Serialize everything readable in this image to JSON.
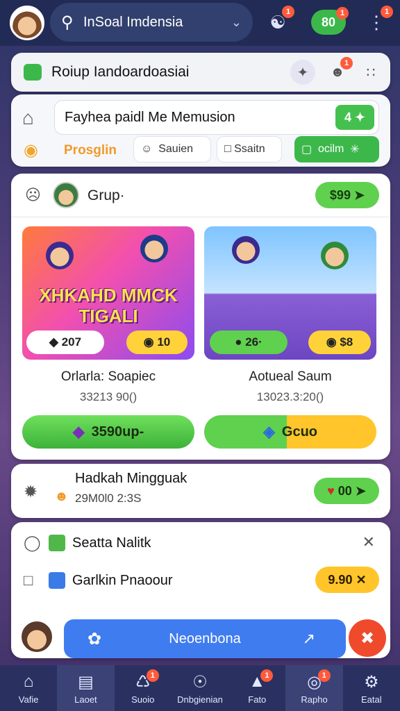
{
  "header": {
    "search_text": "InSoal Imdensia",
    "coin_count": "80",
    "badges": {
      "user": "1",
      "coin": "1",
      "more": "1"
    }
  },
  "group_card": {
    "title": "Roiup Iandoardoasiai",
    "badge": "1"
  },
  "compose": {
    "input_value": "Fayhea paidl Me Memusion",
    "send_label": "4",
    "progress_label": "Prosglin",
    "chip1": "Sauien",
    "chip2": "Ssaitn",
    "chip3": "ocilm"
  },
  "feed": {
    "title": "Grup·",
    "price": "$99",
    "games": [
      {
        "image_text_line1": "XHKAHD MMCK",
        "image_text_line2": "TIGALI",
        "pill_left": "207",
        "pill_right": "10",
        "name": "Orlarla: Soapiec",
        "sub": "33213 90()",
        "button": "3590up-"
      },
      {
        "pill_left": "26·",
        "pill_right": "$8",
        "name": "Aotueal Saum",
        "sub": "13023.3:20()",
        "button": "Gcuo"
      }
    ]
  },
  "activity": {
    "title": "Hadkah Mingguak",
    "time": "29M0l0 2:3S",
    "value": "00"
  },
  "list": {
    "row1": "Seatta Nalitk",
    "row2": "Garlkin Pnaoour",
    "price": "9.90"
  },
  "main_action": {
    "label": "Neoenbona"
  },
  "nav": {
    "items": [
      "Vafie",
      "Laoet",
      "Suoio",
      "Dnbgienian",
      "Fato",
      "Rapho",
      "Eatal"
    ],
    "badges": {
      "suoio": "1",
      "fato": "1",
      "rapho": "1"
    }
  },
  "colors": {
    "primary_blue": "#3f7cf0",
    "accent_green": "#5fd14e",
    "accent_yellow": "#ffc52a",
    "accent_orange": "#f19a2b",
    "danger": "#f04a2c",
    "nav_bg": "#2a3160"
  }
}
